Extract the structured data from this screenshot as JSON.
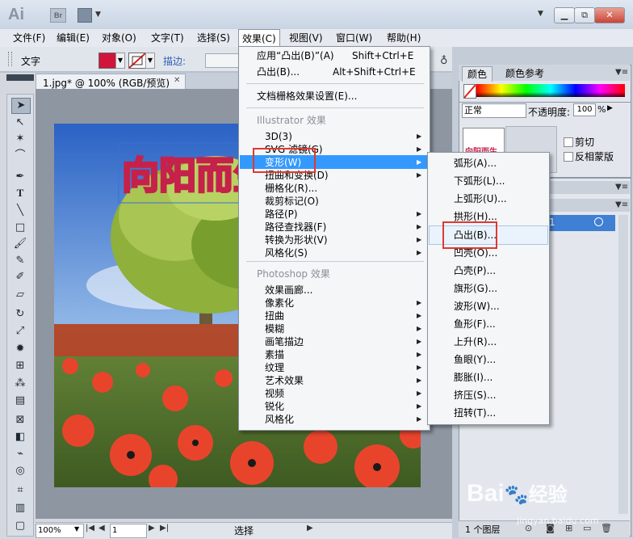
{
  "titlebar": {
    "app_logo": "Ai",
    "bridge_button": "Br",
    "window_buttons": {
      "minimize": "▁",
      "restore": "⧉",
      "close": "✕"
    }
  },
  "menubar": [
    "文件(F)",
    "编辑(E)",
    "对象(O)",
    "文字(T)",
    "选择(S)",
    "效果(C)",
    "视图(V)",
    "窗口(W)",
    "帮助(H)"
  ],
  "control_bar": {
    "mode_label": "文字",
    "stroke_label": "描边:"
  },
  "document": {
    "tab_title": "1.jpg* @ 100% (RGB/预览)",
    "close_icon": "✕"
  },
  "status_bar": {
    "zoom": "100%",
    "page": "1",
    "tool_label": "选择"
  },
  "effect_menu": {
    "apply_last": {
      "label": "应用“凸出(B)”(A)",
      "shortcut": "Shift+Ctrl+E"
    },
    "last_effect": {
      "label": "凸出(B)...",
      "shortcut": "Alt+Shift+Ctrl+E"
    },
    "raster_settings": "文档栅格效果设置(E)...",
    "illustrator_header": "Illustrator 效果",
    "illustrator_items": [
      "3D(3)",
      "SVG 滤镜(G)",
      "变形(W)",
      "扭曲和变换(D)",
      "栅格化(R)...",
      "裁剪标记(O)",
      "路径(P)",
      "路径查找器(F)",
      "转换为形状(V)",
      "风格化(S)"
    ],
    "photoshop_header": "Photoshop 效果",
    "photoshop_items": [
      "效果画廊...",
      "像素化",
      "扭曲",
      "模糊",
      "画笔描边",
      "素描",
      "纹理",
      "艺术效果",
      "视频",
      "锐化",
      "风格化"
    ]
  },
  "distort_submenu": [
    "弧形(A)...",
    "下弧形(L)...",
    "上弧形(U)...",
    "拱形(H)...",
    "凸出(B)...",
    "凹壳(O)...",
    "凸壳(P)...",
    "旗形(G)...",
    "波形(W)...",
    "鱼形(F)...",
    "上升(R)...",
    "鱼眼(Y)...",
    "膨胀(I)...",
    "挤压(S)...",
    "扭转(T)..."
  ],
  "panels": {
    "color_tab": "颜色",
    "color_guide_tab": "颜色参考",
    "blend_mode": "正常",
    "opacity_label": "不透明度:",
    "opacity_value": "100",
    "opacity_unit": "%",
    "clip_label": "剪切",
    "invert_mask_label": "反相蒙版",
    "thumb_text": "向阳而生",
    "layer_number": "1",
    "layers_count": "1 个图层"
  },
  "canvas_text": "向阳而生",
  "watermark": {
    "main": "Bai",
    "paw": "🐾",
    "tail": "经验",
    "sub": "jingyan.baidu.com"
  },
  "colors": {
    "highlight": "#3399ff",
    "annotation_red": "#e0392f",
    "fill": "#d0143c"
  }
}
